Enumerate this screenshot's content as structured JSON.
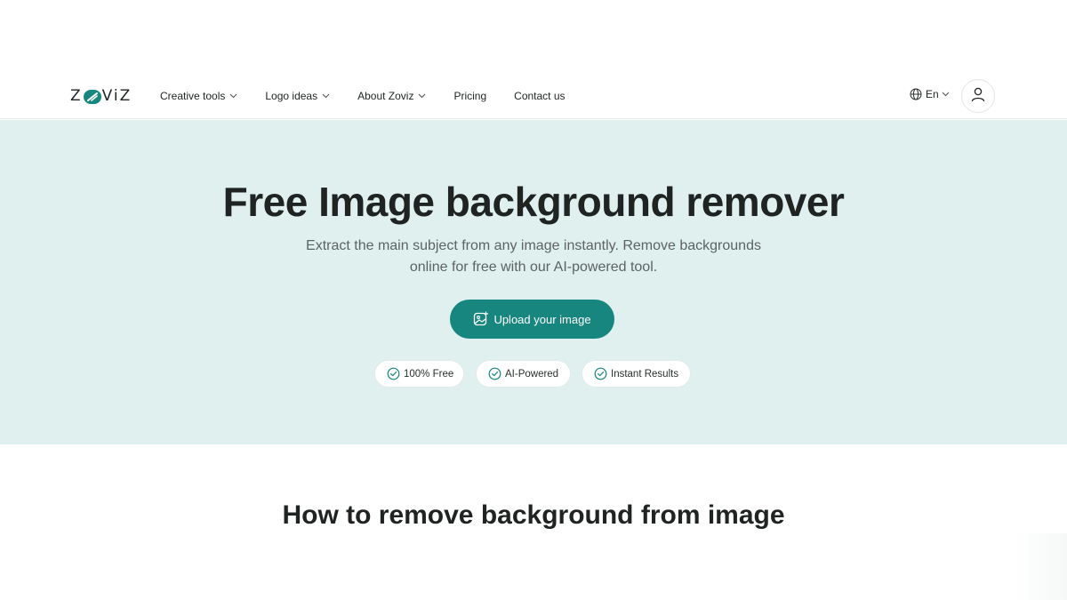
{
  "header": {
    "logo": {
      "left": "Z",
      "right": "ViZ"
    },
    "nav": [
      {
        "label": "Creative tools",
        "has_dropdown": true
      },
      {
        "label": "Logo ideas",
        "has_dropdown": true
      },
      {
        "label": "About Zoviz",
        "has_dropdown": true
      },
      {
        "label": "Pricing",
        "has_dropdown": false
      },
      {
        "label": "Contact us",
        "has_dropdown": false
      }
    ],
    "language": "En"
  },
  "hero": {
    "title": "Free Image background remover",
    "subtitle_line1": "Extract the main subject from any image instantly. Remove backgrounds",
    "subtitle_line2": "online for free with our AI-powered tool.",
    "upload_label": "Upload your image",
    "badges": [
      "100% Free",
      "AI-Powered",
      "Instant Results"
    ]
  },
  "section": {
    "title": "How to remove background from image"
  },
  "colors": {
    "accent": "#17867e",
    "hero_bg": "#dff0ef",
    "text": "#1f2322",
    "muted": "#5c6462"
  }
}
